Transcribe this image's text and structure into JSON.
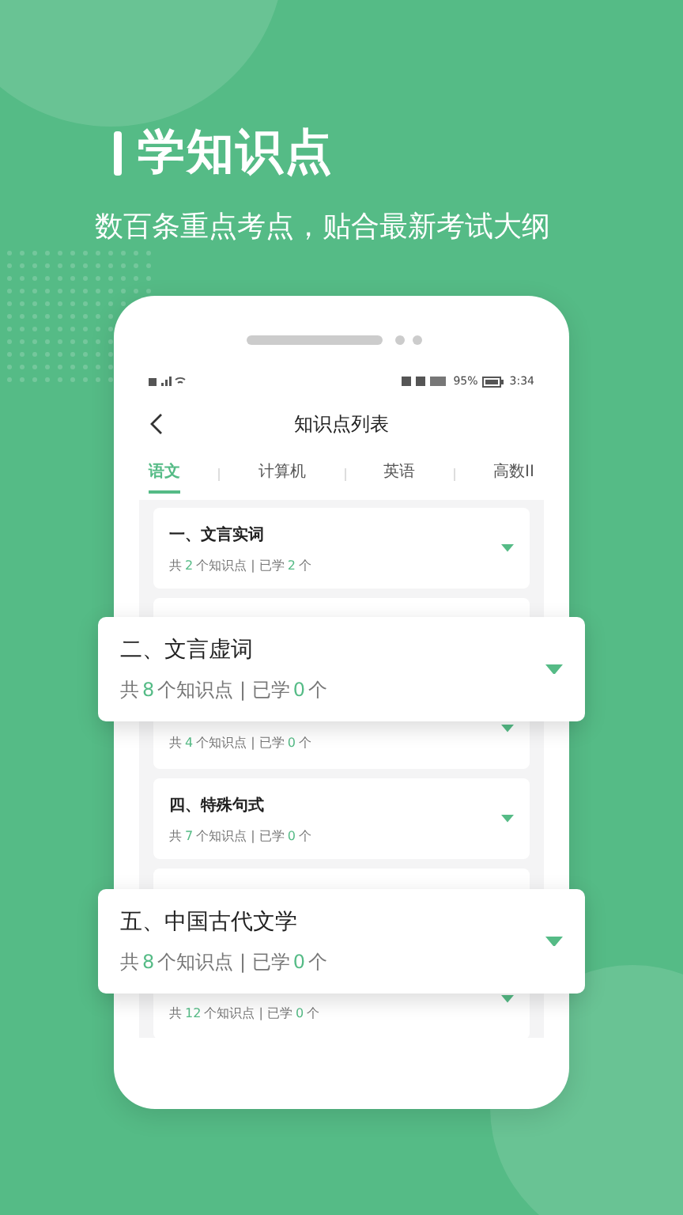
{
  "headline": {
    "title": "学知识点",
    "subtitle": "数百条重点考点，贴合最新考试大纲"
  },
  "phone": {
    "status_bar": {
      "battery": "95%",
      "time": "3:34"
    },
    "nav": {
      "title": "知识点列表"
    },
    "tabs": [
      {
        "label": "语文",
        "selected": true
      },
      {
        "label": "计算机",
        "selected": false
      },
      {
        "label": "英语",
        "selected": false
      },
      {
        "label": "高数II",
        "selected": false
      }
    ],
    "items": [
      {
        "kind": "item",
        "title": "一、文言实词",
        "stats": [
          "共",
          "2",
          "个知识点 | 已学",
          "2",
          "个"
        ]
      },
      {
        "kind": "covered"
      },
      {
        "kind": "partial",
        "stats": [
          "共",
          "4",
          "个知识点 | 已学",
          "0",
          "个"
        ]
      },
      {
        "kind": "item",
        "title": "四、特殊句式",
        "stats": [
          "共",
          "7",
          "个知识点 | 已学",
          "0",
          "个"
        ]
      },
      {
        "kind": "covered"
      },
      {
        "kind": "partial",
        "stats": [
          "共",
          "12",
          "个知识点 | 已学",
          "0",
          "个"
        ]
      }
    ]
  },
  "popouts": [
    {
      "title": "二、文言虚词",
      "stats": [
        "共",
        "8",
        "个知识点 | 已学",
        "0",
        "个"
      ]
    },
    {
      "title": "五、中国古代文学",
      "stats": [
        "共",
        "8",
        "个知识点 | 已学",
        "0",
        "个"
      ]
    }
  ]
}
